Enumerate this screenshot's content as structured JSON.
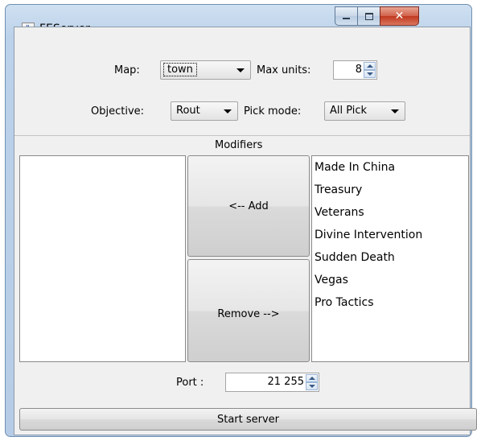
{
  "window": {
    "title": "FEServer"
  },
  "settings": {
    "map_label": "Map:",
    "map_value": "town",
    "max_units_label": "Max units:",
    "max_units_value": "8",
    "objective_label": "Objective:",
    "objective_value": "Rout",
    "pick_mode_label": "Pick mode:",
    "pick_mode_value": "All Pick"
  },
  "modifiers": {
    "header": "Modifiers",
    "add_label": "<-- Add",
    "remove_label": "Remove -->",
    "available": [
      "Made In China",
      "Treasury",
      "Veterans",
      "Divine Intervention",
      "Sudden Death",
      "Vegas",
      "Pro Tactics"
    ]
  },
  "port": {
    "label": "Port :",
    "value": "21 255"
  },
  "start_label": "Start server"
}
